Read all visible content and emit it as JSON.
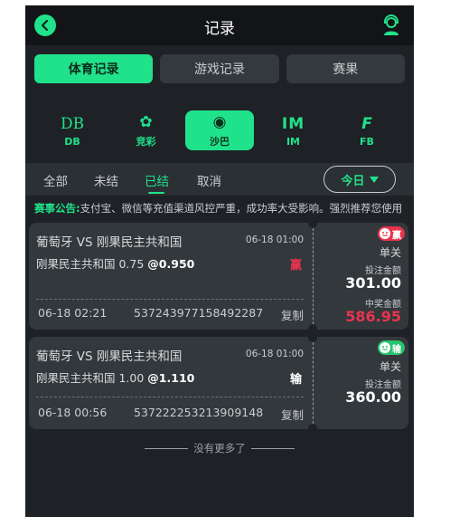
{
  "header": {
    "title": "记录",
    "back_icon": "chevron-left-icon",
    "support_icon": "customer-service-icon"
  },
  "tabs": [
    {
      "label": "体育记录",
      "active": true
    },
    {
      "label": "游戏记录",
      "active": false
    },
    {
      "label": "赛果",
      "active": false
    }
  ],
  "providers": [
    {
      "logo": "DB",
      "label": "DB",
      "active": false
    },
    {
      "logo": "✿",
      "label": "竞彩",
      "active": false
    },
    {
      "logo": "◉",
      "label": "沙巴",
      "active": true
    },
    {
      "logo": "IM",
      "label": "IM",
      "active": false
    },
    {
      "logo": "F",
      "label": "FB",
      "active": false
    }
  ],
  "filters": [
    {
      "label": "全部",
      "active": false
    },
    {
      "label": "未结",
      "active": false
    },
    {
      "label": "已结",
      "active": true
    },
    {
      "label": "取消",
      "active": false
    }
  ],
  "date_filter": {
    "label": "今日"
  },
  "notice": {
    "label": "赛事公告:",
    "text": "支付宝、微信等充值渠道风控严重，成功率大受影响。强烈推荐您使用"
  },
  "bets": [
    {
      "match": "葡萄牙 VS 刚果民主共和国",
      "match_time": "06-18 01:00",
      "pick": "刚果民主共和国 0.75",
      "odds": "@0.950",
      "result": "赢",
      "badge": "赢",
      "bet_type": "单关",
      "stake_label": "投注金额",
      "stake": "301.00",
      "win_label": "中奖金额",
      "win_amount": "586.95",
      "bet_time": "06-18 02:21",
      "bet_id": "537243977158492287",
      "copy_label": "复制"
    },
    {
      "match": "葡萄牙 VS 刚果民主共和国",
      "match_time": "06-18 01:00",
      "pick": "刚果民主共和国 1.00",
      "odds": "@1.110",
      "result": "输",
      "badge": "输",
      "bet_type": "单关",
      "stake_label": "投注金额",
      "stake": "360.00",
      "bet_time": "06-18 00:56",
      "bet_id": "537222253213909148",
      "copy_label": "复制"
    }
  ],
  "footer": {
    "no_more": "没有更多了"
  },
  "colors": {
    "accent": "#20e28a",
    "win": "#e8344e",
    "lose_badge": "#27c46e",
    "background": "#1e2226"
  }
}
